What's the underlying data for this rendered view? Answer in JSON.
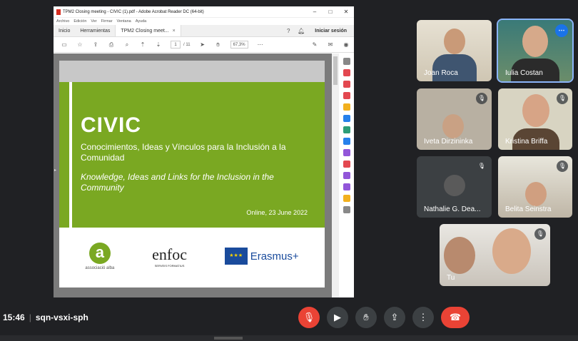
{
  "acrobat": {
    "window_title": "TPM2 Closing meeting - CIVIC (1).pdf - Adobe Acrobat Reader DC (64-bit)",
    "menu": [
      "Archivo",
      "Edición",
      "Ver",
      "Firmar",
      "Ventana",
      "Ayuda"
    ],
    "tabs": {
      "home": "Inicio",
      "tools": "Herramientas",
      "doc": "TPM2 Closing meet..."
    },
    "signin": "Iniciar sesión",
    "page_current": "1",
    "page_total": "/ 11",
    "zoom": "67,3%"
  },
  "slide": {
    "title": "CIVIC",
    "subtitle": "Conocimientos, Ideas y Vínculos para la Inclusión a la Comunidad",
    "subtitle_en": "Knowledge, Ideas and Links for the Inclusion in the Community",
    "date": "Online, 23 June 2022",
    "logo_alba_letter": "a",
    "logo_alba_text": "associació alba",
    "logo_enfoc": "enfoc",
    "logo_enfoc_sub": "SERVEIS FORMATIUS",
    "logo_erasmus": "Erasmus+"
  },
  "participants": [
    {
      "name": "Joan Roca"
    },
    {
      "name": "Iulia Costan"
    },
    {
      "name": "Iveta Dirzininka"
    },
    {
      "name": "Kristina Briffa"
    },
    {
      "name": "Nathalie G. Dea..."
    },
    {
      "name": "Belita Seinstra"
    },
    {
      "name": "Tu"
    }
  ],
  "meeting": {
    "time": "15:46",
    "code": "sqn-vsxi-sph"
  },
  "colors": {
    "slide_green": "#7aa822",
    "hangup": "#ea4335",
    "accent": "#1a73e8"
  }
}
